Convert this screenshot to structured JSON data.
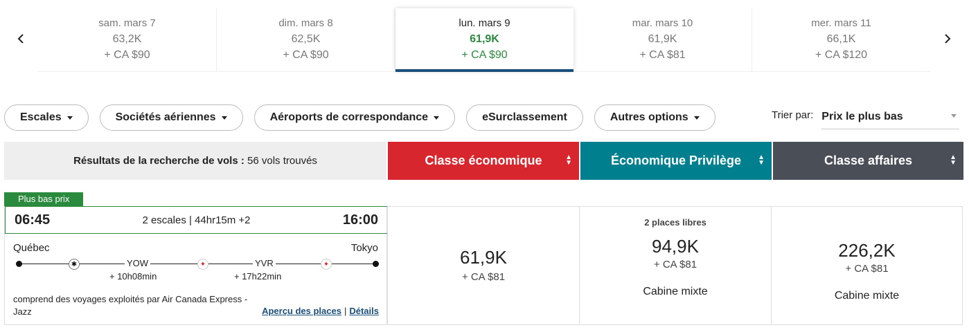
{
  "carousel": {
    "dates": [
      {
        "day": "sam. mars 7",
        "points": "63,2K",
        "tax": "+ CA $90"
      },
      {
        "day": "dim. mars 8",
        "points": "62,5K",
        "tax": "+ CA $90"
      },
      {
        "day": "lun. mars 9",
        "points": "61,9K",
        "tax": "+ CA $90"
      },
      {
        "day": "mar. mars 10",
        "points": "61,9K",
        "tax": "+ CA $81"
      },
      {
        "day": "mer. mars 11",
        "points": "66,1K",
        "tax": "+ CA $120"
      }
    ],
    "prev_icon": "chevron-left-icon",
    "next_icon": "chevron-right-icon"
  },
  "filters": {
    "stops": "Escales",
    "airlines": "Sociétés aériennes",
    "connecting": "Aéroports de correspondance",
    "upgrade": "eSurclassement",
    "more": "Autres options"
  },
  "sort": {
    "label": "Trier par:",
    "value": "Prix le plus bas"
  },
  "header": {
    "results_label": "Résultats de la recherche de vols :",
    "results_count": "56 vols trouvés",
    "economy": "Classe économique",
    "premium": "Économique Privilège",
    "business": "Classe affaires"
  },
  "flight": {
    "badge": "Plus bas prix",
    "depart": "06:45",
    "arrive": "16:00",
    "stops_duration": "2 escales | 44hr15m +2",
    "origin": "Québec",
    "destination": "Tokyo",
    "stop1": "YOW",
    "stop2": "YVR",
    "layover1": "+ 10h08min",
    "layover2": "+ 17h22min",
    "operated": "comprend des voyages exploités par Air Canada Express - Jazz",
    "seat_preview": "Aperçu des places",
    "separator": "|",
    "details": "Détails"
  },
  "fares": {
    "economy": {
      "points": "61,9K",
      "tax": "+ CA $81"
    },
    "premium": {
      "seats": "2 places libres",
      "points": "94,9K",
      "tax": "+ CA $81",
      "cabin": "Cabine mixte"
    },
    "business": {
      "points": "226,2K",
      "tax": "+ CA $81",
      "cabin": "Cabine mixte"
    }
  },
  "colors": {
    "economy": "#d8262e",
    "premium": "#00808f",
    "business": "#4a4f57",
    "green": "#2a8a3e",
    "blue": "#1a4f7c"
  }
}
